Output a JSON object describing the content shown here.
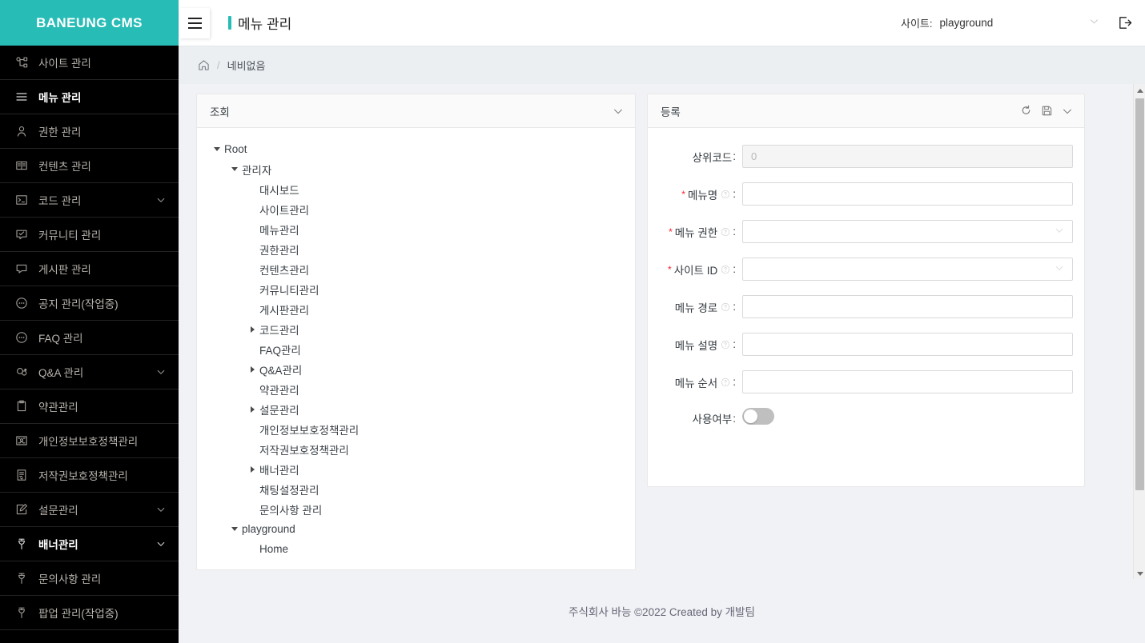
{
  "brand": {
    "title": "BANEUNG CMS"
  },
  "topbar": {
    "page_title": "메뉴 관리",
    "site_label": "사이트:",
    "site_value": "playground",
    "hamburger_name": "메뉴 토글",
    "logout_name": "로그아웃"
  },
  "breadcrumb": {
    "home": "홈",
    "current": "네비없음"
  },
  "sidebar": {
    "items": [
      {
        "label": "사이트 관리",
        "icon": "sitemap-icon",
        "active": false,
        "expandable": false
      },
      {
        "label": "메뉴 관리",
        "icon": "menu-lines-icon",
        "active": true,
        "expandable": false
      },
      {
        "label": "권한 관리",
        "icon": "user-icon",
        "active": false,
        "expandable": false
      },
      {
        "label": "컨텐츠 관리",
        "icon": "book-icon",
        "active": false,
        "expandable": false
      },
      {
        "label": "코드 관리",
        "icon": "console-icon",
        "active": false,
        "expandable": true
      },
      {
        "label": "커뮤니티 관리",
        "icon": "comment-check-icon",
        "active": false,
        "expandable": false
      },
      {
        "label": "게시판 관리",
        "icon": "message-icon",
        "active": false,
        "expandable": false
      },
      {
        "label": "공지 관리(작업중)",
        "icon": "message-dots-icon",
        "active": false,
        "expandable": false
      },
      {
        "label": "FAQ 관리",
        "icon": "message-dots-icon",
        "active": false,
        "expandable": false
      },
      {
        "label": "Q&A 관리",
        "icon": "comments-icon",
        "active": false,
        "expandable": true
      },
      {
        "label": "약관관리",
        "icon": "clipboard-icon",
        "active": false,
        "expandable": false
      },
      {
        "label": "개인정보보호정책관리",
        "icon": "id-card-icon",
        "active": false,
        "expandable": false
      },
      {
        "label": "저작권보호정책관리",
        "icon": "document-icon",
        "active": false,
        "expandable": false
      },
      {
        "label": "설문관리",
        "icon": "edit-icon",
        "active": false,
        "expandable": true
      },
      {
        "label": "배너관리",
        "icon": "pin-icon",
        "active": true,
        "expandable": true
      },
      {
        "label": "문의사항 관리",
        "icon": "pin-icon",
        "active": false,
        "expandable": false
      },
      {
        "label": "팝업 관리(작업중)",
        "icon": "pin-icon",
        "active": false,
        "expandable": false
      }
    ]
  },
  "tree_panel": {
    "title": "조회",
    "collapse_icon": "chevron-down-icon",
    "nodes": [
      {
        "label": "Root",
        "depth": 0,
        "toggle": "down"
      },
      {
        "label": "관리자",
        "depth": 1,
        "toggle": "down"
      },
      {
        "label": "대시보드",
        "depth": 2,
        "toggle": "none"
      },
      {
        "label": "사이트관리",
        "depth": 2,
        "toggle": "none"
      },
      {
        "label": "메뉴관리",
        "depth": 2,
        "toggle": "none"
      },
      {
        "label": "권한관리",
        "depth": 2,
        "toggle": "none"
      },
      {
        "label": "컨텐츠관리",
        "depth": 2,
        "toggle": "none"
      },
      {
        "label": "커뮤니티관리",
        "depth": 2,
        "toggle": "none"
      },
      {
        "label": "게시판관리",
        "depth": 2,
        "toggle": "none"
      },
      {
        "label": "코드관리",
        "depth": 2,
        "toggle": "right"
      },
      {
        "label": "FAQ관리",
        "depth": 2,
        "toggle": "none"
      },
      {
        "label": "Q&A관리",
        "depth": 2,
        "toggle": "right"
      },
      {
        "label": "약관관리",
        "depth": 2,
        "toggle": "none"
      },
      {
        "label": "설문관리",
        "depth": 2,
        "toggle": "right"
      },
      {
        "label": "개인정보보호정책관리",
        "depth": 2,
        "toggle": "none"
      },
      {
        "label": "저작권보호정책관리",
        "depth": 2,
        "toggle": "none"
      },
      {
        "label": "배너관리",
        "depth": 2,
        "toggle": "right"
      },
      {
        "label": "채팅설정관리",
        "depth": 2,
        "toggle": "none"
      },
      {
        "label": "문의사항 관리",
        "depth": 2,
        "toggle": "none"
      },
      {
        "label": "playground",
        "depth": 1,
        "toggle": "down"
      },
      {
        "label": "Home",
        "depth": 2,
        "toggle": "none"
      }
    ]
  },
  "form_panel": {
    "title": "등록",
    "actions": [
      {
        "name": "reset-icon",
        "label": "초기화"
      },
      {
        "name": "save-icon",
        "label": "저장"
      },
      {
        "name": "chevron-down-icon",
        "label": "접기"
      }
    ],
    "fields": [
      {
        "label": "상위코드",
        "type": "input",
        "value": "0",
        "placeholder": "",
        "required": false,
        "help": false,
        "disabled": true
      },
      {
        "label": "메뉴명",
        "type": "input",
        "value": "",
        "placeholder": "",
        "required": true,
        "help": true,
        "disabled": false
      },
      {
        "label": "메뉴 권한",
        "type": "select",
        "value": "",
        "placeholder": "",
        "required": true,
        "help": true,
        "disabled": false
      },
      {
        "label": "사이트 ID",
        "type": "select",
        "value": "",
        "placeholder": "",
        "required": true,
        "help": true,
        "disabled": false
      },
      {
        "label": "메뉴 경로",
        "type": "input",
        "value": "",
        "placeholder": "",
        "required": false,
        "help": true,
        "disabled": false
      },
      {
        "label": "메뉴 설명",
        "type": "input",
        "value": "",
        "placeholder": "",
        "required": false,
        "help": true,
        "disabled": false
      },
      {
        "label": "메뉴 순서",
        "type": "input",
        "value": "",
        "placeholder": "",
        "required": false,
        "help": true,
        "disabled": false
      },
      {
        "label": "사용여부",
        "type": "switch",
        "value": "off",
        "placeholder": "",
        "required": false,
        "help": false,
        "disabled": false
      }
    ]
  },
  "footer": {
    "text": "주식회사 바능 ©2022 Created by 개발팀"
  },
  "colors": {
    "accent": "#28bcb6",
    "sidebar_bg": "#000000",
    "content_bg": "#f0f2f5",
    "required": "#f5222d"
  }
}
